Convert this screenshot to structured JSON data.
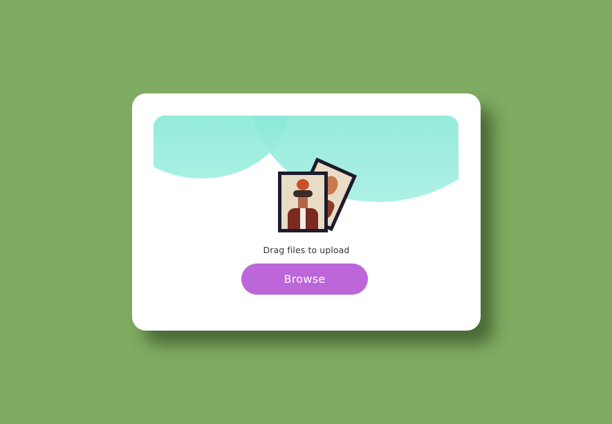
{
  "upload": {
    "prompt": "Drag files to upload",
    "browse_label": "Browse"
  },
  "colors": {
    "background": "#80ab62",
    "card": "#ffffff",
    "accent_teal": "#7de6d2",
    "button": "#bd66d9",
    "frame": "#1d1b2d"
  },
  "icons": {
    "illustration": "picture-frames-icon"
  }
}
